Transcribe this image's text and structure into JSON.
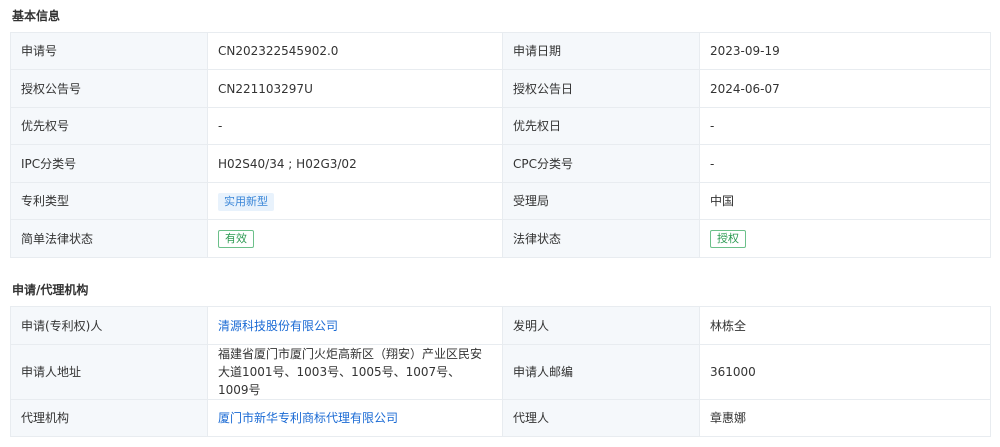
{
  "basic": {
    "title": "基本信息",
    "rows": [
      [
        "申请号",
        "CN202322545902.0",
        "申请日期",
        "2023-09-19"
      ],
      [
        "授权公告号",
        "CN221103297U",
        "授权公告日",
        "2024-06-07"
      ],
      [
        "优先权号",
        "-",
        "优先权日",
        "-"
      ],
      [
        "IPC分类号",
        "H02S40/34 ; H02G3/02",
        "CPC分类号",
        "-"
      ],
      [
        "专利类型",
        "实用新型",
        "受理局",
        "中国"
      ],
      [
        "简单法律状态",
        "有效",
        "法律状态",
        "授权"
      ]
    ]
  },
  "agency": {
    "title": "申请/代理机构",
    "rows": [
      [
        "申请(专利权)人",
        "清源科技股份有限公司",
        "发明人",
        "林栋全"
      ],
      [
        "申请人地址",
        "福建省厦门市厦门火炬高新区（翔安）产业区民安大道1001号、1003号、1005号、1007号、1009号",
        "申请人邮编",
        "361000"
      ],
      [
        "代理机构",
        "厦门市新华专利商标代理有限公司",
        "代理人",
        "章惠娜"
      ]
    ]
  },
  "colors": {
    "label_bg": "#f5f8fb",
    "border": "#e8ecf0",
    "link": "#1a6ad4",
    "tag_blue": "#3a86d8",
    "tag_green": "#2c9a52"
  }
}
